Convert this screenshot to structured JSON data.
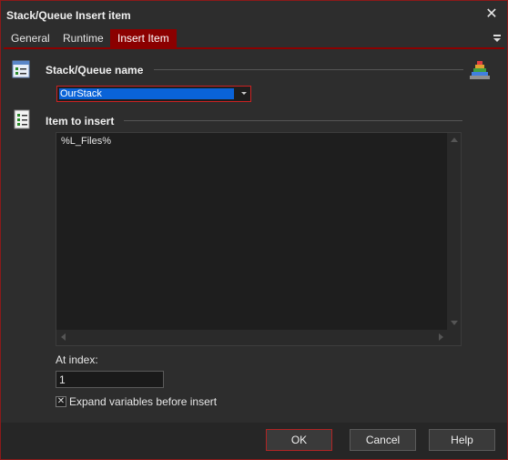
{
  "window": {
    "title": "Stack/Queue Insert item",
    "close_glyph": "✕"
  },
  "tabs": [
    {
      "label": "General"
    },
    {
      "label": "Runtime"
    },
    {
      "label": "Insert Item",
      "active": true
    }
  ],
  "stack_section": {
    "label": "Stack/Queue name",
    "icon": "list-icon",
    "selected_value": "OurStack"
  },
  "item_section": {
    "label": "Item to insert",
    "icon": "checklist-icon",
    "value": "%L_Files%"
  },
  "index": {
    "label": "At index:",
    "value": "1"
  },
  "expand_vars": {
    "label": "Expand variables before insert",
    "checked": true,
    "glyph": "✕"
  },
  "buttons": {
    "ok": "OK",
    "cancel": "Cancel",
    "help": "Help"
  },
  "colors": {
    "accent": "#8b0000",
    "selection": "#0a63d8",
    "background": "#2d2d2d"
  }
}
